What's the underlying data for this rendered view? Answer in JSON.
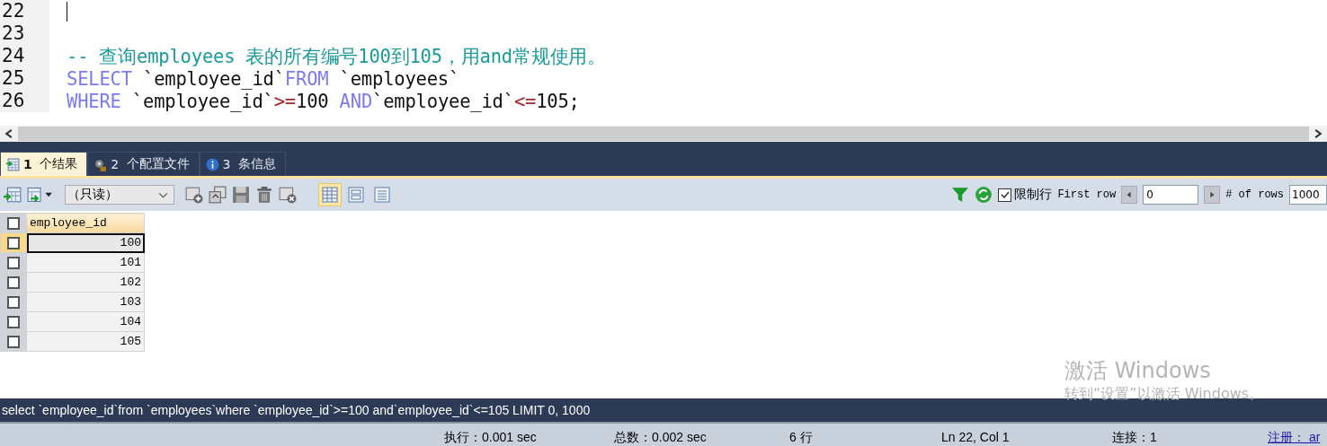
{
  "editor": {
    "lines": [
      {
        "number": "22"
      },
      {
        "number": "23"
      },
      {
        "number": "24",
        "tokens": [
          {
            "kind": "comment",
            "text": "-- 查询employees 表的所有编号100到105，用and常规使用。"
          }
        ]
      },
      {
        "number": "25",
        "tokens": [
          {
            "kind": "keyword",
            "text": "SELECT"
          },
          {
            "kind": "plain",
            "text": " `employee_id`"
          },
          {
            "kind": "keyword",
            "text": "FROM"
          },
          {
            "kind": "plain",
            "text": " `employees`"
          }
        ]
      },
      {
        "number": "26",
        "tokens": [
          {
            "kind": "keyword",
            "text": "WHERE"
          },
          {
            "kind": "plain",
            "text": " `employee_id`"
          },
          {
            "kind": "operator",
            "text": ">="
          },
          {
            "kind": "plain",
            "text": "100 "
          },
          {
            "kind": "keyword",
            "text": "AND"
          },
          {
            "kind": "plain",
            "text": "`employee_id`"
          },
          {
            "kind": "operator",
            "text": "<="
          },
          {
            "kind": "plain",
            "text": "105;"
          }
        ]
      }
    ]
  },
  "tabs": [
    {
      "number": "1",
      "label": "个结果",
      "kind": "results",
      "selected": true
    },
    {
      "number": "2",
      "label": "个配置文件",
      "kind": "profile",
      "selected": false
    },
    {
      "number": "3",
      "label": "条信息",
      "kind": "info",
      "selected": false
    }
  ],
  "toolbar": {
    "mode": "（只读）",
    "views": [
      {
        "kind": "grid",
        "selected": true
      },
      {
        "kind": "form",
        "selected": false
      },
      {
        "kind": "text",
        "selected": false
      }
    ],
    "limit_rows": {
      "label": "限制行",
      "checked": true
    },
    "first_row_label": "First row",
    "first_row": "0",
    "rows_label": "# of rows",
    "rows": "1000"
  },
  "grid": {
    "column": "employee_id",
    "all_checked": false,
    "rows": [
      {
        "value": "100",
        "selected": true
      },
      {
        "value": "101",
        "selected": false
      },
      {
        "value": "102",
        "selected": false
      },
      {
        "value": "103",
        "selected": false
      },
      {
        "value": "104",
        "selected": false
      },
      {
        "value": "105",
        "selected": false
      }
    ]
  },
  "activation_notice": {
    "title": "激活 Windows",
    "hint": "转到“设置”以激活 Windows。"
  },
  "query": "select `employee_id`from `employees`where `employee_id`>=100 and`employee_id`<=105 LIMIT 0, 1000",
  "status_bar": {
    "exec": "执行：0.001 sec",
    "total": "总数：0.002 sec",
    "rows": "6 行",
    "position": "Ln 22, Col 1",
    "connections": "连接：1",
    "register": "注册： ar"
  }
}
